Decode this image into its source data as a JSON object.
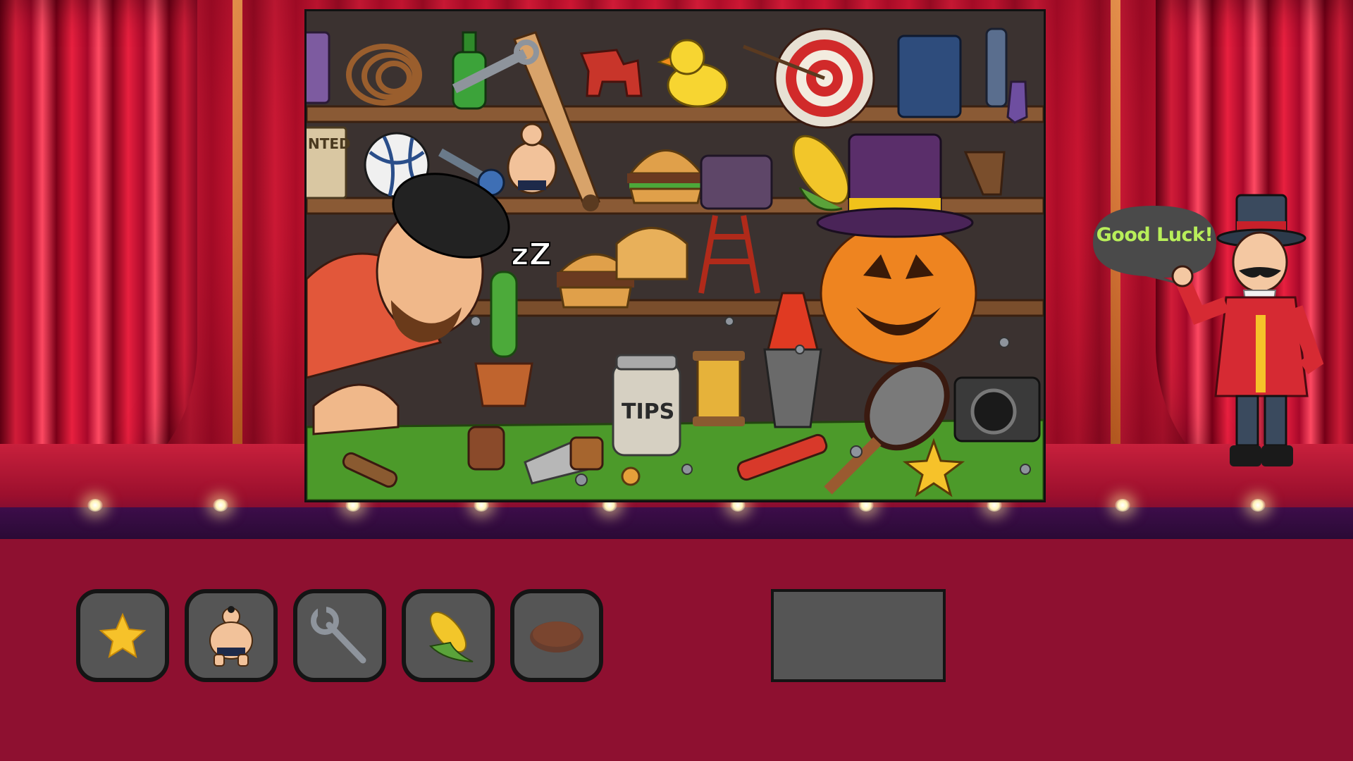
{
  "speech": {
    "text": "Good Luck!"
  },
  "scene": {
    "jar_label": "TIPS",
    "poster_label": "NTED",
    "snore": "zZ"
  },
  "inventory": {
    "items": [
      {
        "icon": "star-icon",
        "found": true
      },
      {
        "icon": "sumo-wrestler-icon",
        "found": true
      },
      {
        "icon": "wrench-icon",
        "found": true
      },
      {
        "icon": "corn-icon",
        "found": true
      },
      {
        "icon": "brown-disc-icon",
        "found": false
      }
    ]
  },
  "colors": {
    "background": "#8e1030",
    "slot_fill": "#555555",
    "slot_border": "#141414",
    "speech_text": "#b8ee5a",
    "speech_bubble": "#4a4a4a"
  }
}
